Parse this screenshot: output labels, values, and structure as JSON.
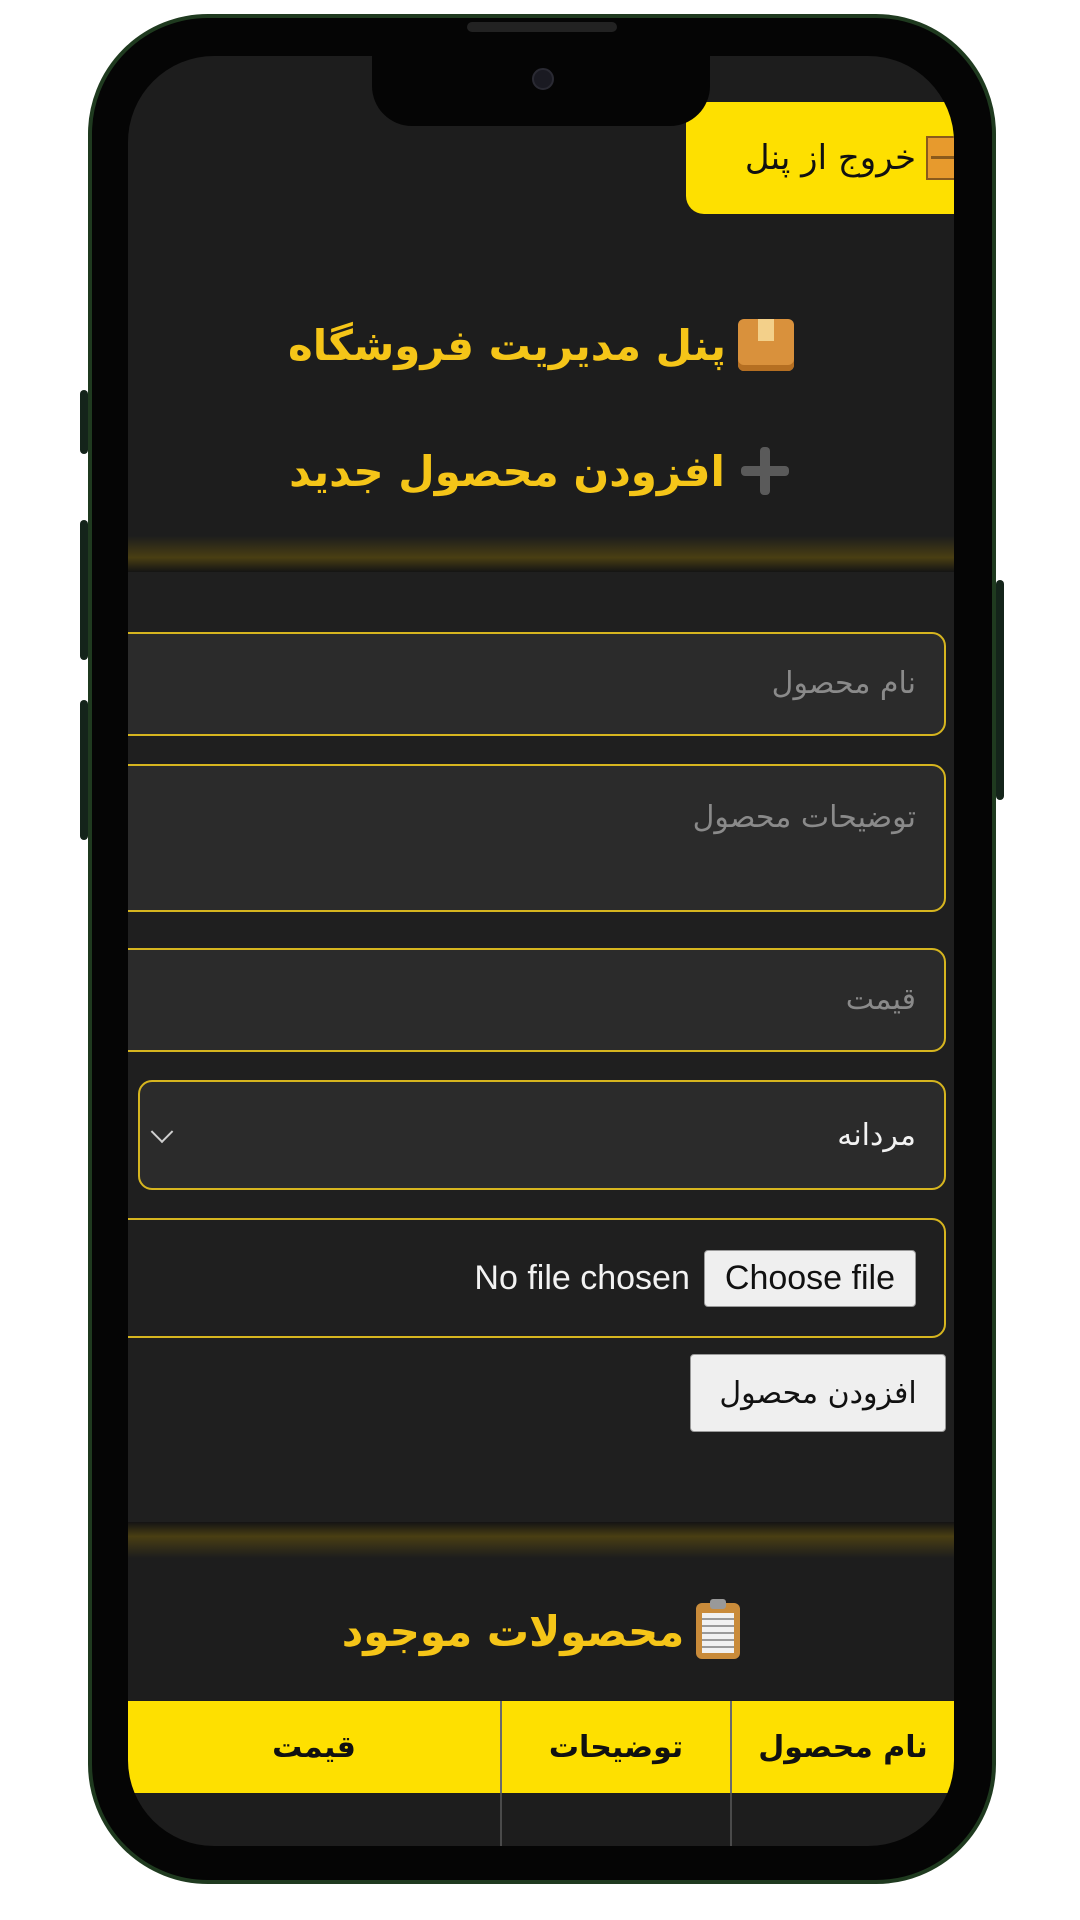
{
  "header": {
    "logout_label": "خروج از پنل",
    "panel_title": "پنل مدیریت فروشگاه",
    "add_product_heading": "افزودن محصول جدید"
  },
  "form": {
    "name_placeholder": "نام محصول",
    "description_placeholder": "توضیحات  محصول",
    "price_placeholder": "قیمت",
    "category_selected": "مردانه",
    "file_button_label": "Choose file",
    "file_status": "No file chosen",
    "submit_label": "افزودن محصول"
  },
  "products": {
    "heading": "محصولات موجود",
    "columns": [
      "نام محصول",
      "توضیحات",
      "قیمت"
    ]
  },
  "colors": {
    "accent": "#fee000",
    "title_text": "#f5c518",
    "background": "#1d1d1d",
    "field_border": "#d6b51f"
  },
  "icons": {
    "logout": "door-icon",
    "panel": "package-icon",
    "add": "plus-icon",
    "products": "clipboard-icon",
    "select": "chevron-down-icon"
  }
}
